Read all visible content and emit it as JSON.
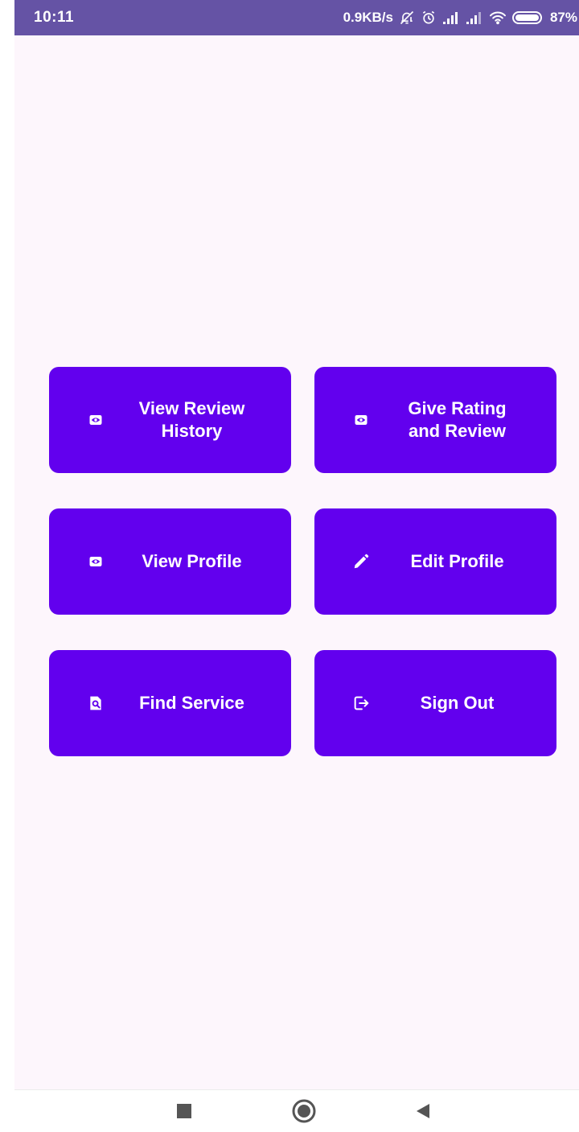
{
  "status_bar": {
    "time": "10:11",
    "speed": "0.9KB/s",
    "battery": "87%",
    "icons": [
      "bell-muted-icon",
      "alarm-icon",
      "signal-icon",
      "signal-icon",
      "wifi-icon",
      "battery-icon"
    ]
  },
  "buttons": [
    {
      "label": "View Review\nHistory",
      "icon": "eye-icon"
    },
    {
      "label": "Give Rating\nand Review",
      "icon": "eye-icon"
    },
    {
      "label": "View Profile",
      "icon": "eye-icon"
    },
    {
      "label": "Edit Profile",
      "icon": "pencil-icon"
    },
    {
      "label": "Find Service",
      "icon": "find-in-page-icon"
    },
    {
      "label": "Sign Out",
      "icon": "logout-icon"
    }
  ],
  "nav_bar": {
    "icons": [
      "recents-square-icon",
      "home-circle-icon",
      "back-triangle-icon"
    ]
  },
  "colors": {
    "status_bar": "#6553a5",
    "button": "#6200ee",
    "background": "#fdf6fc"
  }
}
